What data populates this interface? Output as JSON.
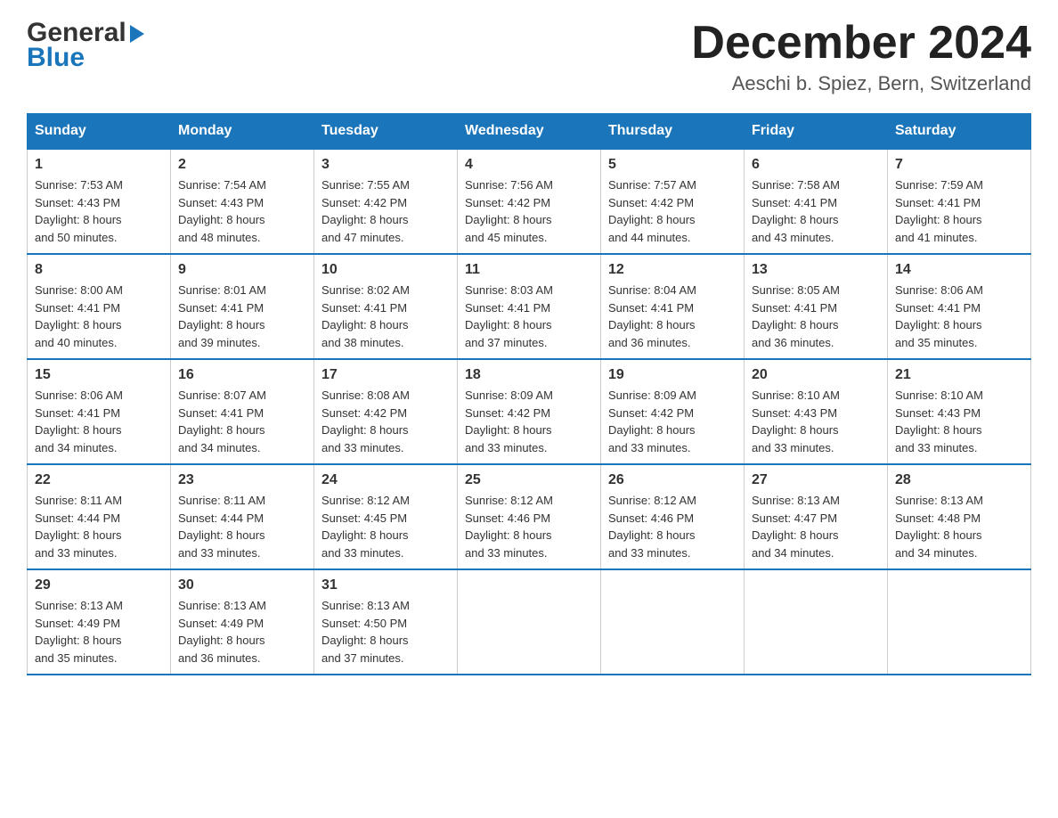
{
  "header": {
    "logo": {
      "general": "General",
      "blue": "Blue"
    },
    "title": "December 2024",
    "location": "Aeschi b. Spiez, Bern, Switzerland"
  },
  "days_of_week": [
    "Sunday",
    "Monday",
    "Tuesday",
    "Wednesday",
    "Thursday",
    "Friday",
    "Saturday"
  ],
  "weeks": [
    [
      {
        "day": "1",
        "sunrise": "7:53 AM",
        "sunset": "4:43 PM",
        "daylight": "8 hours and 50 minutes."
      },
      {
        "day": "2",
        "sunrise": "7:54 AM",
        "sunset": "4:43 PM",
        "daylight": "8 hours and 48 minutes."
      },
      {
        "day": "3",
        "sunrise": "7:55 AM",
        "sunset": "4:42 PM",
        "daylight": "8 hours and 47 minutes."
      },
      {
        "day": "4",
        "sunrise": "7:56 AM",
        "sunset": "4:42 PM",
        "daylight": "8 hours and 45 minutes."
      },
      {
        "day": "5",
        "sunrise": "7:57 AM",
        "sunset": "4:42 PM",
        "daylight": "8 hours and 44 minutes."
      },
      {
        "day": "6",
        "sunrise": "7:58 AM",
        "sunset": "4:41 PM",
        "daylight": "8 hours and 43 minutes."
      },
      {
        "day": "7",
        "sunrise": "7:59 AM",
        "sunset": "4:41 PM",
        "daylight": "8 hours and 41 minutes."
      }
    ],
    [
      {
        "day": "8",
        "sunrise": "8:00 AM",
        "sunset": "4:41 PM",
        "daylight": "8 hours and 40 minutes."
      },
      {
        "day": "9",
        "sunrise": "8:01 AM",
        "sunset": "4:41 PM",
        "daylight": "8 hours and 39 minutes."
      },
      {
        "day": "10",
        "sunrise": "8:02 AM",
        "sunset": "4:41 PM",
        "daylight": "8 hours and 38 minutes."
      },
      {
        "day": "11",
        "sunrise": "8:03 AM",
        "sunset": "4:41 PM",
        "daylight": "8 hours and 37 minutes."
      },
      {
        "day": "12",
        "sunrise": "8:04 AM",
        "sunset": "4:41 PM",
        "daylight": "8 hours and 36 minutes."
      },
      {
        "day": "13",
        "sunrise": "8:05 AM",
        "sunset": "4:41 PM",
        "daylight": "8 hours and 36 minutes."
      },
      {
        "day": "14",
        "sunrise": "8:06 AM",
        "sunset": "4:41 PM",
        "daylight": "8 hours and 35 minutes."
      }
    ],
    [
      {
        "day": "15",
        "sunrise": "8:06 AM",
        "sunset": "4:41 PM",
        "daylight": "8 hours and 34 minutes."
      },
      {
        "day": "16",
        "sunrise": "8:07 AM",
        "sunset": "4:41 PM",
        "daylight": "8 hours and 34 minutes."
      },
      {
        "day": "17",
        "sunrise": "8:08 AM",
        "sunset": "4:42 PM",
        "daylight": "8 hours and 33 minutes."
      },
      {
        "day": "18",
        "sunrise": "8:09 AM",
        "sunset": "4:42 PM",
        "daylight": "8 hours and 33 minutes."
      },
      {
        "day": "19",
        "sunrise": "8:09 AM",
        "sunset": "4:42 PM",
        "daylight": "8 hours and 33 minutes."
      },
      {
        "day": "20",
        "sunrise": "8:10 AM",
        "sunset": "4:43 PM",
        "daylight": "8 hours and 33 minutes."
      },
      {
        "day": "21",
        "sunrise": "8:10 AM",
        "sunset": "4:43 PM",
        "daylight": "8 hours and 33 minutes."
      }
    ],
    [
      {
        "day": "22",
        "sunrise": "8:11 AM",
        "sunset": "4:44 PM",
        "daylight": "8 hours and 33 minutes."
      },
      {
        "day": "23",
        "sunrise": "8:11 AM",
        "sunset": "4:44 PM",
        "daylight": "8 hours and 33 minutes."
      },
      {
        "day": "24",
        "sunrise": "8:12 AM",
        "sunset": "4:45 PM",
        "daylight": "8 hours and 33 minutes."
      },
      {
        "day": "25",
        "sunrise": "8:12 AM",
        "sunset": "4:46 PM",
        "daylight": "8 hours and 33 minutes."
      },
      {
        "day": "26",
        "sunrise": "8:12 AM",
        "sunset": "4:46 PM",
        "daylight": "8 hours and 33 minutes."
      },
      {
        "day": "27",
        "sunrise": "8:13 AM",
        "sunset": "4:47 PM",
        "daylight": "8 hours and 34 minutes."
      },
      {
        "day": "28",
        "sunrise": "8:13 AM",
        "sunset": "4:48 PM",
        "daylight": "8 hours and 34 minutes."
      }
    ],
    [
      {
        "day": "29",
        "sunrise": "8:13 AM",
        "sunset": "4:49 PM",
        "daylight": "8 hours and 35 minutes."
      },
      {
        "day": "30",
        "sunrise": "8:13 AM",
        "sunset": "4:49 PM",
        "daylight": "8 hours and 36 minutes."
      },
      {
        "day": "31",
        "sunrise": "8:13 AM",
        "sunset": "4:50 PM",
        "daylight": "8 hours and 37 minutes."
      },
      null,
      null,
      null,
      null
    ]
  ],
  "labels": {
    "sunrise": "Sunrise:",
    "sunset": "Sunset:",
    "daylight": "Daylight:"
  },
  "colors": {
    "header_bg": "#1a75bb",
    "header_text": "#ffffff",
    "border": "#1a75bb",
    "text": "#333333"
  }
}
